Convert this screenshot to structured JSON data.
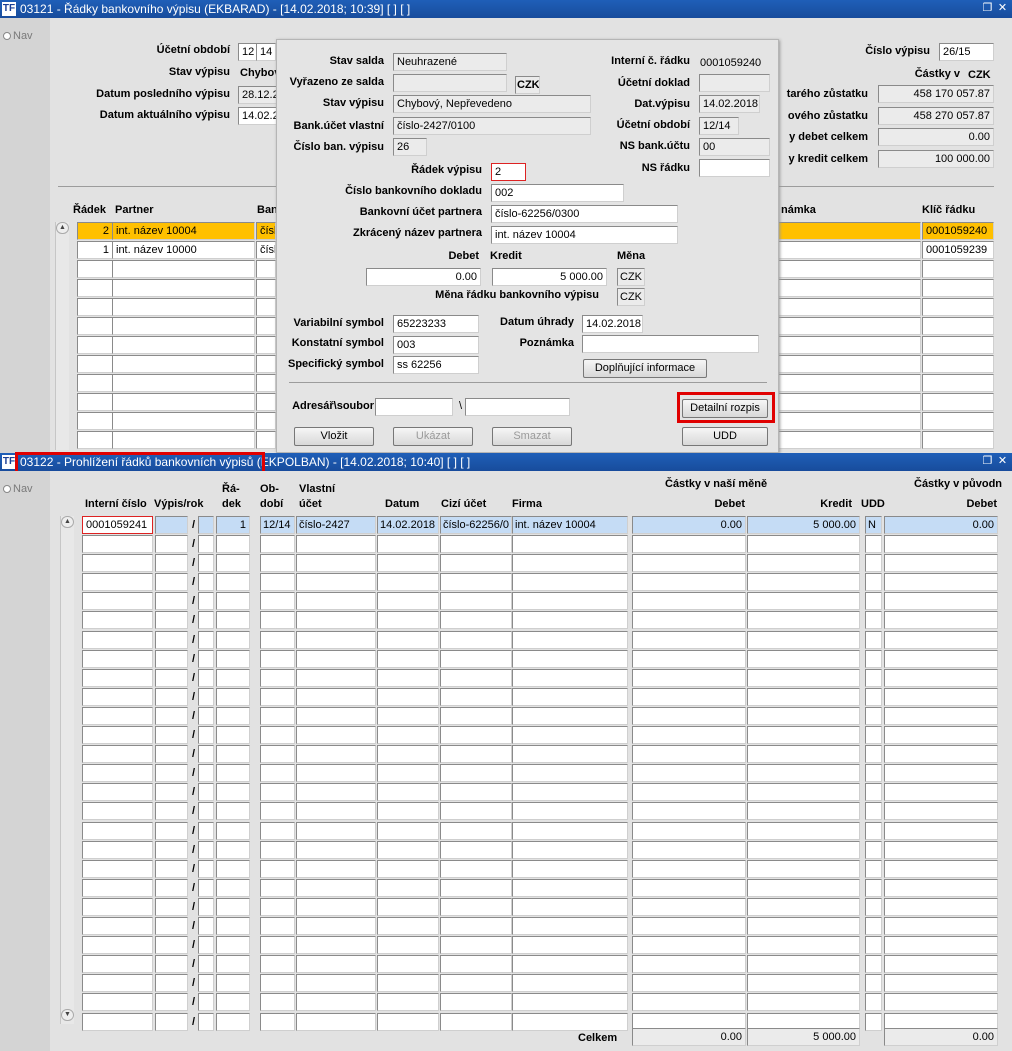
{
  "win1": {
    "title": "03121 - Řádky bankovního výpisu (EKBARAD) - [14.02.2018; 10:39]  [ ]  [ ]",
    "nav": "Nav",
    "ucetni_obdobi_label": "Účetní období",
    "ucetni_obdobi_v1": "12",
    "ucetni_obdobi_v2": "14",
    "stav_vypisu_label": "Stav výpisu",
    "stav_vypisu_value": "Chybový",
    "datum_posl_label": "Datum posledního výpisu",
    "datum_posl_value": "28.12.2",
    "datum_akt_label": "Datum aktuálního výpisu",
    "datum_akt_value": "14.02.2",
    "cislo_vypisu_label": "Číslo výpisu",
    "cislo_vypisu_value": "26/15",
    "castky_label": "Částky v",
    "currency": "CZK",
    "stary_label": "tarého zůstatku",
    "stary_value": "458 170 057.87",
    "novy_label": "ového zůstatku",
    "novy_value": "458 270 057.87",
    "debet_celkem_label": "y debet celkem",
    "debet_celkem_value": "0.00",
    "kredit_celkem_label": "y kredit celkem",
    "kredit_celkem_value": "100 000.00",
    "col_radek": "Řádek",
    "col_partner": "Partner",
    "col_ban": "Ban",
    "col_poznamka": "námka",
    "col_klic": "Klíč řádku",
    "rows": [
      {
        "radek": "2",
        "partner": "int. název 10004",
        "ban": "čísl",
        "klic": "0001059240"
      },
      {
        "radek": "1",
        "partner": "int. název 10000",
        "ban": "čísl",
        "klic": "0001059239"
      }
    ]
  },
  "dialog": {
    "stav_salda_label": "Stav salda",
    "stav_salda_value": "Neuhrazené",
    "vyrazeno_label": "Vyřazeno ze salda",
    "vyrazeno_currency": "CZK",
    "stav_vypisu_label": "Stav výpisu",
    "stav_vypisu_value": "Chybový, Nepřevedeno",
    "bank_ucet_label": "Bank.účet vlastní",
    "bank_ucet_value": "číslo-2427/0100",
    "cislo_ban_label": "Číslo ban. výpisu",
    "cislo_ban_value": "26",
    "interni_label": "Interní č. řádku",
    "interni_value": "0001059240",
    "ucetni_doklad_label": "Účetní doklad",
    "dat_vypisu_label": "Dat.výpisu",
    "dat_vypisu_value": "14.02.2018",
    "ucetni_obdobi_label": "Účetní období",
    "ucetni_obdobi_value": "12/14",
    "ns_bank_label": "NS bank.účtu",
    "ns_bank_value": "00",
    "ns_radku_label": "NS řádku",
    "radek_label": "Řádek výpisu",
    "radek_value": "2",
    "cislo_dokladu_label": "Číslo bankovního dokladu",
    "cislo_dokladu_value": "002",
    "ucet_partnera_label": "Bankovní účet partnera",
    "ucet_partnera_value": "číslo-62256/0300",
    "nazev_partnera_label": "Zkrácený název partnera",
    "nazev_partnera_value": "int. název 10004",
    "debet_label": "Debet",
    "kredit_label": "Kredit",
    "mena_label": "Měna",
    "debet_value": "0.00",
    "kredit_value": "5 000.00",
    "mena_value": "CZK",
    "mena_radku_label": "Měna řádku bankovního výpisu",
    "mena_radku_value": "CZK",
    "var_label": "Variabilní symbol",
    "var_value": "65223233",
    "datum_uhrady_label": "Datum úhrady",
    "datum_uhrady_value": "14.02.2018",
    "konst_label": "Konstatní symbol",
    "konst_value": "003",
    "poznamka_label": "Poznámka",
    "spec_label": "Specifický symbol",
    "spec_value": "ss 62256",
    "doplnujici_button": "Doplňující informace",
    "adresar_label": "Adresář\\soubor",
    "slash": "\\",
    "detailni_button": "Detailní rozpis",
    "vlozit_button": "Vložit",
    "ukazat_button": "Ukázat",
    "smazat_button": "Smazat",
    "udd_button": "UDD"
  },
  "win2": {
    "title": "03122 - Prohlížení řádků bankovních výpisů (EKPOLBAN) - [14.02.2018; 10:40]  [ ]  [ ]",
    "nav": "Nav",
    "col_interni": "Interní číslo",
    "col_vypis": "Výpis/rok",
    "col_radek1": "Řá-",
    "col_radek2": "dek",
    "col_obdobi1": "Ob-",
    "col_obdobi2": "dobí",
    "col_vlastni1": "Vlastní",
    "col_vlastni2": "účet",
    "col_datum": "Datum",
    "col_cizi": "Cizí účet",
    "col_firma": "Firma",
    "group_nase": "Částky v naší měně",
    "col_debet": "Debet",
    "col_kredit": "Kredit",
    "col_udd": "UDD",
    "group_puvodni": "Částky v původn",
    "col_debet2": "Debet",
    "slash": "/",
    "row": {
      "interni": "0001059241",
      "radek": "1",
      "obdobi": "12/14",
      "vlastni": "číslo-2427",
      "datum": "14.02.2018",
      "cizi": "číslo-62256/0",
      "firma": "int. název 10004",
      "debet": "0.00",
      "kredit": "5 000.00",
      "udd": "N",
      "debet2": "0.00"
    },
    "celkem_label": "Celkem",
    "celkem_debet": "0.00",
    "celkem_kredit": "5 000.00",
    "celkem_debet2": "0.00"
  }
}
